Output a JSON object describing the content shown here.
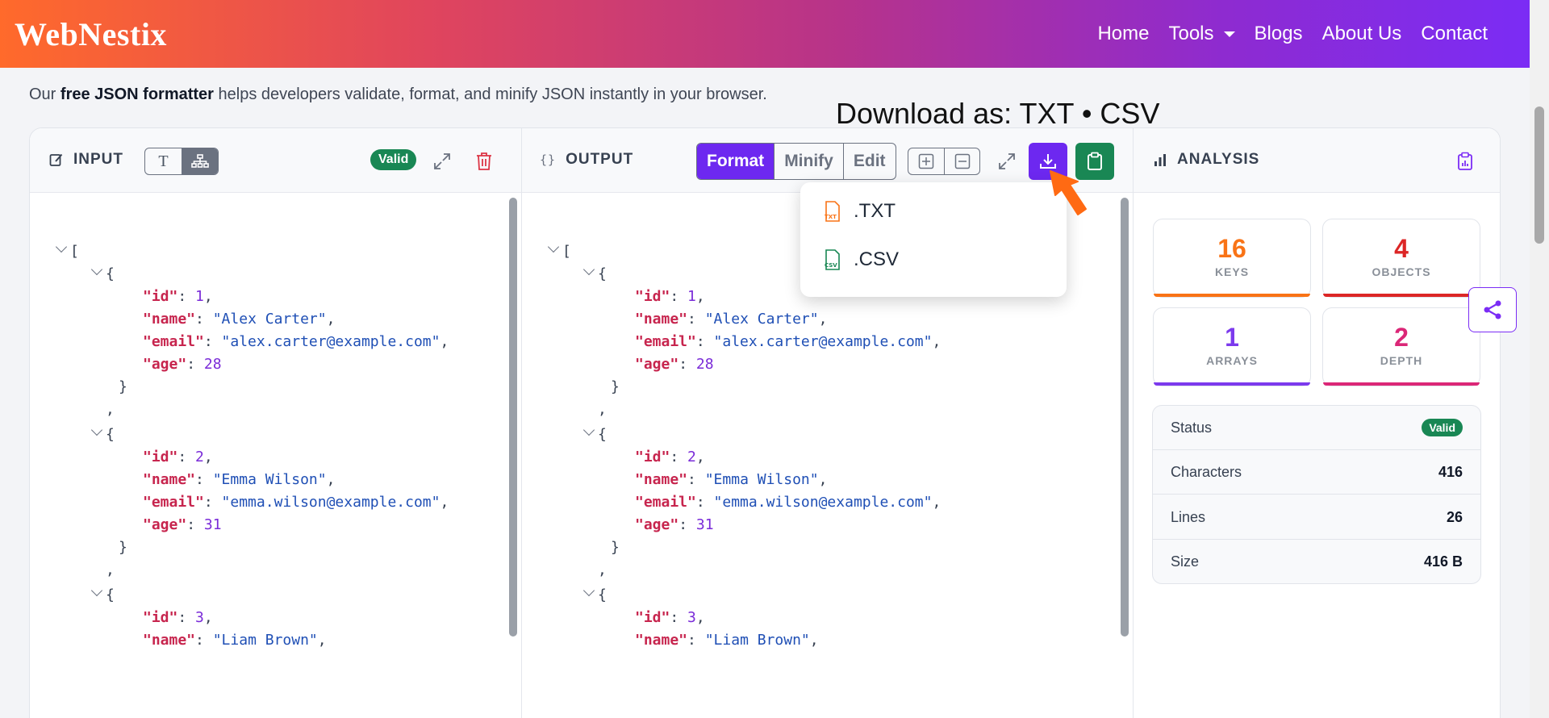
{
  "header": {
    "logo": "WebNestix",
    "nav": [
      {
        "label": "Home"
      },
      {
        "label": "Tools"
      },
      {
        "label": "Blogs"
      },
      {
        "label": "About Us"
      },
      {
        "label": "Contact"
      }
    ]
  },
  "intro": {
    "prefix": "Our ",
    "bold": "free JSON formatter",
    "suffix": " helps developers validate, format, and minify JSON instantly in your browser."
  },
  "download_title": "Download as: TXT • CSV",
  "input_panel": {
    "label": "INPUT",
    "toggle_text": "T",
    "status": "Valid"
  },
  "output_panel": {
    "label": "OUTPUT",
    "braces": "{}",
    "modes": [
      "Format",
      "Minify",
      "Edit"
    ]
  },
  "download_menu": {
    "items": [
      {
        "label": ".TXT",
        "tag": "TXT"
      },
      {
        "label": ".CSV",
        "tag": "CSV"
      }
    ]
  },
  "analysis": {
    "label": "ANALYSIS",
    "stats": [
      {
        "value": "16",
        "label": "KEYS",
        "color": "#f97316"
      },
      {
        "value": "4",
        "label": "OBJECTS",
        "color": "#dc2626"
      },
      {
        "value": "1",
        "label": "ARRAYS",
        "color": "#7c3aed"
      },
      {
        "value": "2",
        "label": "DEPTH",
        "color": "#db2777"
      }
    ],
    "table": [
      {
        "label": "Status",
        "value": "Valid"
      },
      {
        "label": "Characters",
        "value": "416"
      },
      {
        "label": "Lines",
        "value": "26"
      },
      {
        "label": "Size",
        "value": "416 B"
      }
    ]
  },
  "json_records": [
    {
      "id": "1",
      "name": "\"Alex Carter\"",
      "email": "\"alex.carter@example.com\"",
      "age": "28"
    },
    {
      "id": "2",
      "name": "\"Emma Wilson\"",
      "email": "\"emma.wilson@example.com\"",
      "age": "31"
    },
    {
      "id": "3",
      "name": "\"Liam Brown\""
    }
  ],
  "json_keys": {
    "id": "\"id\"",
    "name": "\"name\"",
    "email": "\"email\"",
    "age": "\"age\""
  },
  "colors": {
    "accent": "#6d28f0",
    "success": "#198754"
  }
}
